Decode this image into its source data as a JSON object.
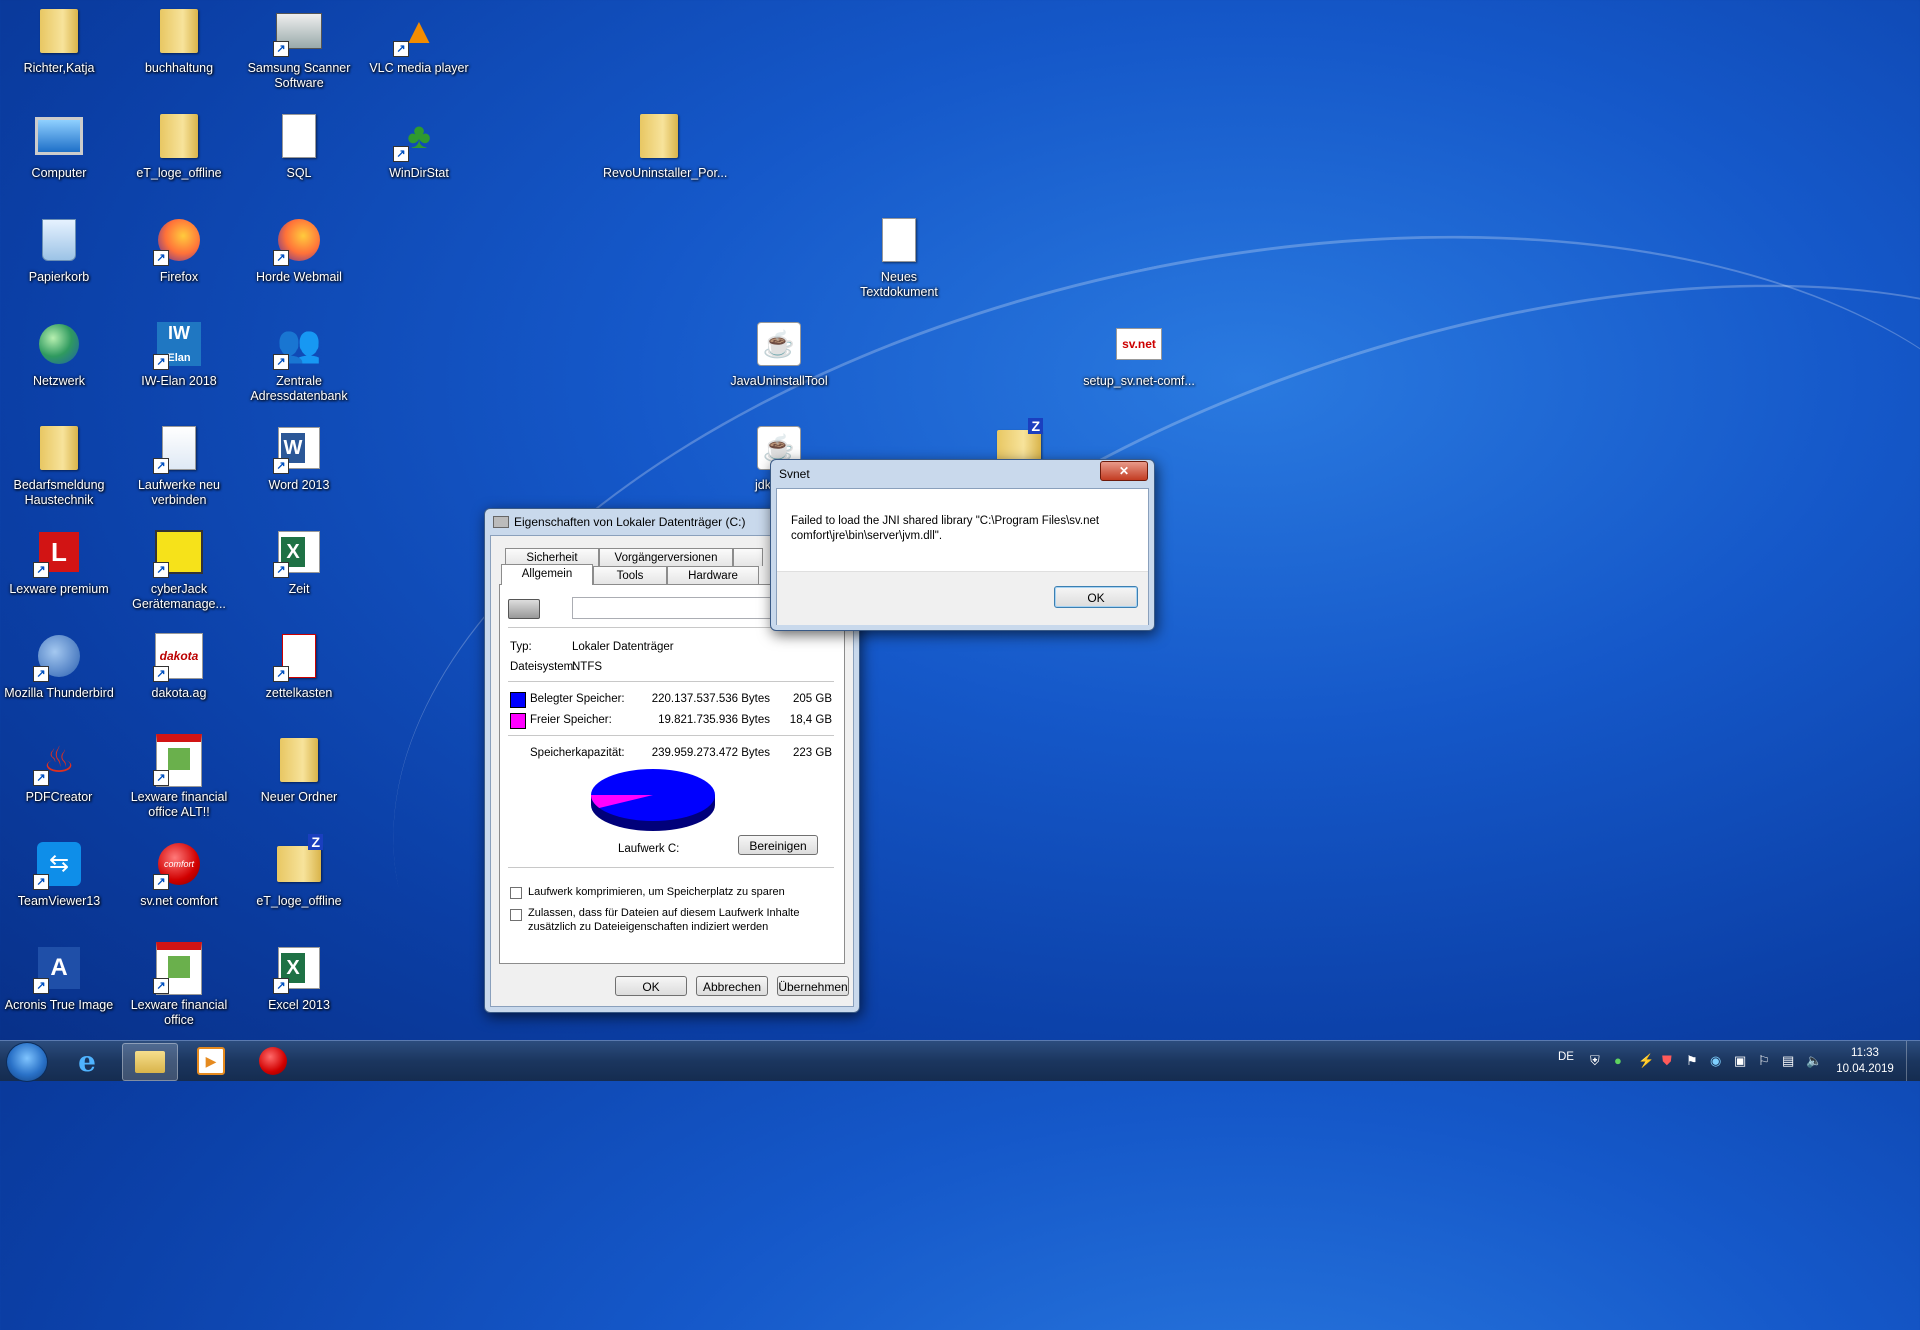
{
  "desktop": {
    "icons": [
      {
        "label": "Richter,Katja",
        "icon": "folder-icon"
      },
      {
        "label": "buchhaltung",
        "icon": "folder-icon"
      },
      {
        "label": "Samsung Scanner Software",
        "icon": "scanner-icon"
      },
      {
        "label": "VLC media player",
        "icon": "vlc-cone-icon"
      },
      {
        "label": "Computer",
        "icon": "computer-icon"
      },
      {
        "label": "eT_loge_offline",
        "icon": "folder-icon"
      },
      {
        "label": "SQL",
        "icon": "document-icon"
      },
      {
        "label": "WinDirStat",
        "icon": "tree-icon"
      },
      {
        "label": "RevoUninstaller_Por...",
        "icon": "folder-icon"
      },
      {
        "label": "Papierkorb",
        "icon": "recycle-bin-icon"
      },
      {
        "label": "Firefox",
        "icon": "firefox-icon"
      },
      {
        "label": "Horde Webmail",
        "icon": "firefox-icon"
      },
      {
        "label": "Neues Textdokument",
        "icon": "text-document-icon"
      },
      {
        "label": "Netzwerk",
        "icon": "network-icon"
      },
      {
        "label": "IW-Elan 2018",
        "icon": "iw-elan-icon"
      },
      {
        "label": "Zentrale Adressdatenbank",
        "icon": "users-icon"
      },
      {
        "label": "JavaUninstallTool",
        "icon": "java-icon"
      },
      {
        "label": "setup_sv.net-comf...",
        "icon": "svnet-setup-icon"
      },
      {
        "label": "Bedarfsmeldung Haustechnik",
        "icon": "folder-icon"
      },
      {
        "label": "Laufwerke neu verbinden",
        "icon": "python-script-icon"
      },
      {
        "label": "Word 2013",
        "icon": "word-icon"
      },
      {
        "label": "jdk-8u20",
        "icon": "java-icon"
      },
      {
        "label": "",
        "icon": "zip-folder-icon"
      },
      {
        "label": "Lexware premium",
        "icon": "lexware-icon"
      },
      {
        "label": "cyberJack Gerätemanage...",
        "icon": "chip-icon"
      },
      {
        "label": "Zeit",
        "icon": "excel-icon"
      },
      {
        "label": "Mozilla Thunderbird",
        "icon": "thunderbird-icon"
      },
      {
        "label": "dakota.ag",
        "icon": "dakota-icon"
      },
      {
        "label": "zettelkasten",
        "icon": "zettelkasten-icon"
      },
      {
        "label": "PDFCreator",
        "icon": "pdfcreator-icon"
      },
      {
        "label": "Lexware financial office ALT!!",
        "icon": "lexware-calendar-icon"
      },
      {
        "label": "Neuer Ordner",
        "icon": "folder-icon"
      },
      {
        "label": "TeamViewer13",
        "icon": "teamviewer-icon"
      },
      {
        "label": "sv.net comfort",
        "icon": "svnet-comfort-icon"
      },
      {
        "label": "eT_loge_offline",
        "icon": "zip-folder-icon"
      },
      {
        "label": "Acronis True Image",
        "icon": "acronis-icon"
      },
      {
        "label": "Lexware financial office",
        "icon": "lexware-calendar-icon"
      },
      {
        "label": "Excel 2013",
        "icon": "excel-icon"
      }
    ]
  },
  "properties_dialog": {
    "title": "Eigenschaften von Lokaler Datenträger (C:)",
    "tabs_row1": [
      "Sicherheit",
      "Vorgängerversionen"
    ],
    "tabs_row2": [
      "Allgemein",
      "Tools",
      "Hardware"
    ],
    "active_tab": "Allgemein",
    "name_value": "",
    "type_label": "Typ:",
    "type_value": "Lokaler Datenträger",
    "fs_label": "Dateisystem:",
    "fs_value": "NTFS",
    "used_label": "Belegter Speicher:",
    "used_bytes": "220.137.537.536 Bytes",
    "used_gb": "205 GB",
    "used_color": "#0000ff",
    "free_label": "Freier Speicher:",
    "free_bytes": "19.821.735.936 Bytes",
    "free_gb": "18,4 GB",
    "free_color": "#ff00ff",
    "capacity_label": "Speicherkapazität:",
    "capacity_bytes": "239.959.273.472 Bytes",
    "capacity_gb": "223 GB",
    "used_fraction": 0.917,
    "drive_label": "Laufwerk C:",
    "cleanup_button": "Bereinigen",
    "compress_checkbox": "Laufwerk komprimieren, um Speicherplatz zu sparen",
    "compress_checked": false,
    "index_checkbox_line1": "Zulassen, dass für Dateien auf diesem Laufwerk Inhalte",
    "index_checkbox_line2": "zusätzlich zu Dateieigenschaften indiziert werden",
    "index_checked": false,
    "ok_button": "OK",
    "cancel_button": "Abbrechen",
    "apply_button": "Übernehmen"
  },
  "error_dialog": {
    "title": "Svnet",
    "message_line1": "Failed to load the JNI shared library \"C:\\Program Files\\sv.net",
    "message_line2": "comfort\\jre\\bin\\server\\jvm.dll\".",
    "ok_button": "OK",
    "close_glyph": "✕"
  },
  "taskbar": {
    "language": "DE",
    "time": "11:33",
    "date": "10.04.2019",
    "pinned": [
      "start-orb",
      "internet-explorer-icon",
      "explorer-icon",
      "media-player-icon",
      "record-app-icon"
    ]
  }
}
